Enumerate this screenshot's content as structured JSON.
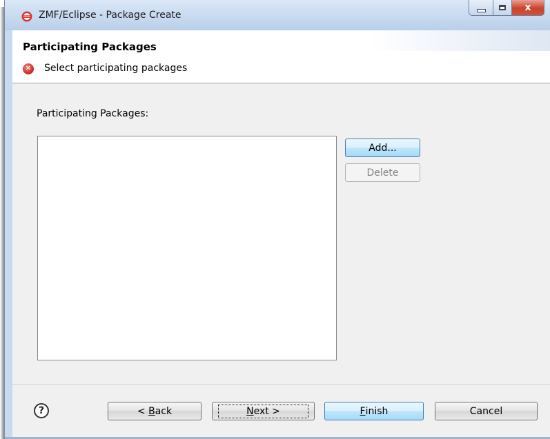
{
  "window": {
    "title": "ZMF/Eclipse - Package Create",
    "controls": {
      "minimize": "minimize",
      "maximize": "maximize",
      "close": "x"
    }
  },
  "banner": {
    "title": "Participating Packages",
    "message": "Select participating packages",
    "message_icon": "error-icon"
  },
  "content": {
    "list_label": "Participating Packages:",
    "list_items": [],
    "add_label": "Add...",
    "delete_label": "Delete"
  },
  "footer": {
    "help_glyph": "?",
    "back_prefix": "< ",
    "back_mnemonic": "B",
    "back_rest": "ack",
    "next_mnemonic": "N",
    "next_rest": "ext >",
    "finish_mnemonic": "F",
    "finish_rest": "inish",
    "cancel_label": "Cancel"
  },
  "colors": {
    "titlebar": "#c6d9ef",
    "error": "#d0312d",
    "default_button_border": "#3c7fb1"
  }
}
